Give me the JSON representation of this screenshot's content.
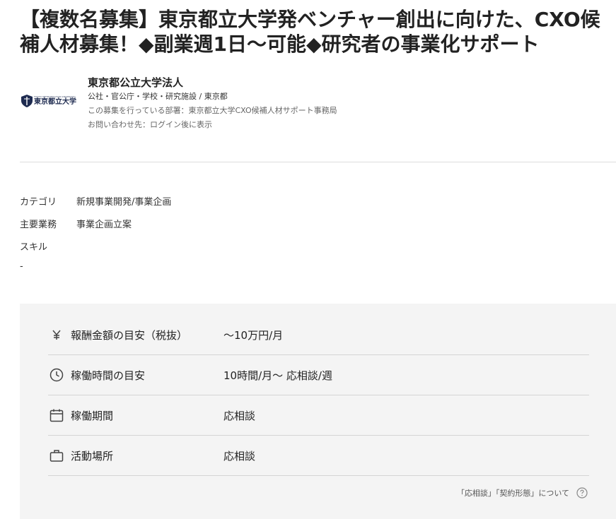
{
  "job": {
    "title": "【複数名募集】東京都立大学発ベンチャー創出に向けた、CXO候補人材募集！◆副業週1日〜可能◆研究者の事業化サポート"
  },
  "org": {
    "logo_small": "TOKYO METROPOLITAN UNIVERSITY",
    "logo_name": "東京都立大学",
    "name": "東京都公立大学法人",
    "meta": "公社・官公庁・学校・研究施設 / 東京都",
    "department": "この募集を行っている部署：東京都立大学CXO候補人材サポート事務局",
    "contact": "お問い合わせ先：ログイン後に表示"
  },
  "attributes": {
    "category_label": "カテゴリ",
    "category_value": "新規事業開発/事業企画",
    "main_work_label": "主要業務",
    "main_work_value": "事業企画立案",
    "skill_label": "スキル",
    "skill_value": "-"
  },
  "terms": [
    {
      "icon": "yen-icon",
      "label": "報酬金額の目安（税抜）",
      "value": "〜10万円/月"
    },
    {
      "icon": "clock-icon",
      "label": "稼働時間の目安",
      "value": "10時間/月〜 応相談/週"
    },
    {
      "icon": "calendar-icon",
      "label": "稼働期間",
      "value": "応相談"
    },
    {
      "icon": "briefcase-icon",
      "label": "活動場所",
      "value": "応相談"
    }
  ],
  "note": {
    "text": "「応相談」「契約形態」について",
    "icon": "help-circle-icon"
  },
  "colors": {
    "text": "#222222",
    "muted": "#666666",
    "panel_bg": "#f4f4f4",
    "divider": "#dddddd",
    "logo_navy": "#1d2a4f"
  }
}
